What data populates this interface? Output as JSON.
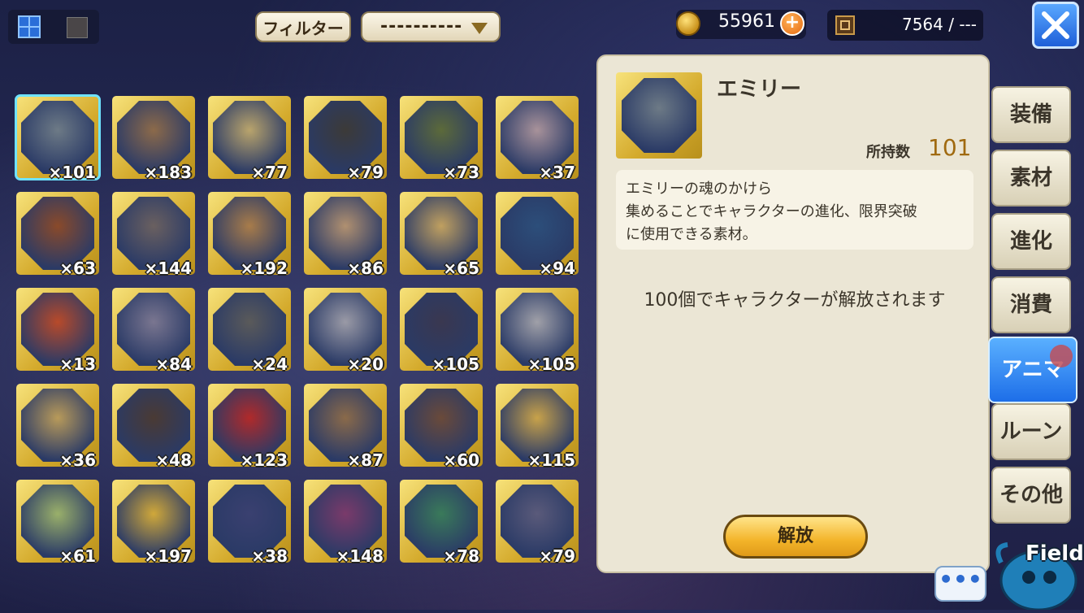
{
  "header": {
    "filter_label": "フィルター",
    "filter_value": "----------",
    "gold": "55961",
    "capacity": "7564 / ---"
  },
  "items": [
    {
      "count": "×101",
      "color": "#6d7a86",
      "selected": true
    },
    {
      "count": "×183",
      "color": "#8c6a4a"
    },
    {
      "count": "×77",
      "color": "#b9a46c"
    },
    {
      "count": "×79",
      "color": "#3c3a38"
    },
    {
      "count": "×73",
      "color": "#5c6a3a"
    },
    {
      "count": "×37",
      "color": "#a8929a"
    },
    {
      "count": "×63",
      "color": "#8a4a2a"
    },
    {
      "count": "×144",
      "color": "#6a6060"
    },
    {
      "count": "×192",
      "color": "#a87c4a"
    },
    {
      "count": "×86",
      "color": "#b09070"
    },
    {
      "count": "×65",
      "color": "#c0a060"
    },
    {
      "count": "×94",
      "color": "#2c4e7a"
    },
    {
      "count": "×13",
      "color": "#b84a2a"
    },
    {
      "count": "×84",
      "color": "#7a7690"
    },
    {
      "count": "×24",
      "color": "#5a5a5a"
    },
    {
      "count": "×20",
      "color": "#9a9aa6"
    },
    {
      "count": "×105",
      "color": "#3a3850"
    },
    {
      "count": "×105",
      "color": "#a0a0a8"
    },
    {
      "count": "×36",
      "color": "#b89a5a"
    },
    {
      "count": "×48",
      "color": "#4a3a34"
    },
    {
      "count": "×123",
      "color": "#b02a2a"
    },
    {
      "count": "×87",
      "color": "#8a6a4a"
    },
    {
      "count": "×60",
      "color": "#6a4a3a"
    },
    {
      "count": "×115",
      "color": "#c8a24a"
    },
    {
      "count": "×61",
      "color": "#9ab06a"
    },
    {
      "count": "×197",
      "color": "#d0a83a"
    },
    {
      "count": "×38",
      "color": "#3a4070"
    },
    {
      "count": "×148",
      "color": "#7a3a6a"
    },
    {
      "count": "×78",
      "color": "#3a7a5a"
    },
    {
      "count": "×79",
      "color": "#5a5a7a"
    }
  ],
  "detail": {
    "name": "エミリー",
    "owned_label": "所持数",
    "owned_value": "101",
    "description": [
      "エミリーの魂のかけら",
      "集めることでキャラクターの進化、限界突破",
      "に使用できる素材。"
    ],
    "unlock_note": "100個でキャラクターが解放されます",
    "unlock_button": "解放"
  },
  "tabs": [
    {
      "label": "装備"
    },
    {
      "label": "素材"
    },
    {
      "label": "進化"
    },
    {
      "label": "消費"
    },
    {
      "label": "アニマ",
      "active": true
    },
    {
      "label": "ルーン"
    },
    {
      "label": "その他"
    }
  ],
  "chat_label": "•••",
  "field_label": "Field"
}
